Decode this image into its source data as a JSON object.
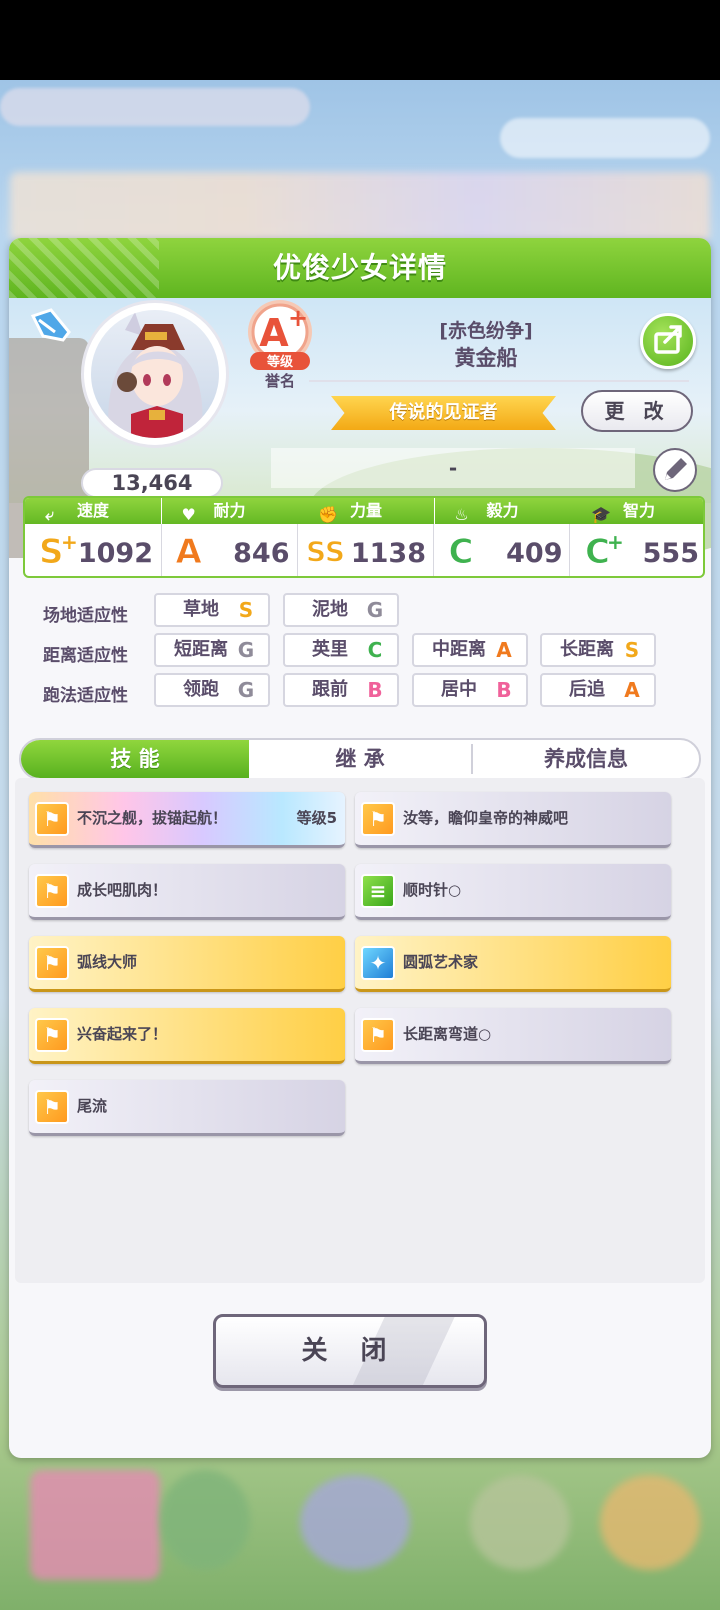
{
  "background": {
    "top_banner_text": "",
    "top_right_button": ""
  },
  "panel": {
    "title": "优俊少女详情"
  },
  "profile": {
    "points": "13,464",
    "grade": "A+",
    "grade_label": "等级",
    "grade_sub": "誉名",
    "outfit": "[赤色纷争]",
    "name": "黄金船",
    "epithet": "传说的见证者",
    "change_label": "更 改",
    "motto": "-"
  },
  "stats": [
    {
      "label": "速度",
      "icon": "shoe-icon",
      "glyph": "⤶",
      "rank": "S",
      "plus": true,
      "value": "1092",
      "rank_color": "#f2a81a"
    },
    {
      "label": "耐力",
      "icon": "heart-icon",
      "glyph": "♥",
      "rank": "A",
      "plus": false,
      "value": "846",
      "rank_color": "#f07a1e"
    },
    {
      "label": "力量",
      "icon": "arm-icon",
      "glyph": "✊",
      "rank": "SS",
      "plus": false,
      "value": "1138",
      "rank_color": "#f2a81a"
    },
    {
      "label": "毅力",
      "icon": "flame-icon",
      "glyph": "♨",
      "rank": "C",
      "plus": false,
      "value": "409",
      "rank_color": "#3fb24f"
    },
    {
      "label": "智力",
      "icon": "cap-icon",
      "glyph": "🎓",
      "rank": "C",
      "plus": true,
      "value": "555",
      "rank_color": "#3fb24f"
    }
  ],
  "aptitude": {
    "track_label": "场地适应性",
    "distance_label": "距离适应性",
    "style_label": "跑法适应性",
    "track": [
      {
        "name": "草地",
        "grade": "S"
      },
      {
        "name": "泥地",
        "grade": "G"
      }
    ],
    "distance": [
      {
        "name": "短距离",
        "grade": "G"
      },
      {
        "name": "英里",
        "grade": "C"
      },
      {
        "name": "中距离",
        "grade": "A"
      },
      {
        "name": "长距离",
        "grade": "S"
      }
    ],
    "style": [
      {
        "name": "领跑",
        "grade": "G"
      },
      {
        "name": "跟前",
        "grade": "B"
      },
      {
        "name": "居中",
        "grade": "B"
      },
      {
        "name": "后追",
        "grade": "A"
      }
    ]
  },
  "grade_colors": {
    "S": "#f2a81a",
    "A": "#f07a1e",
    "B": "#f0619a",
    "C": "#3fb24f",
    "G": "#8f8b99"
  },
  "tabs": [
    "技 能",
    "继 承",
    "养成信息"
  ],
  "skills": [
    {
      "name": "不沉之舰，拔锚起航！",
      "level": "等级5",
      "style": "rainbow",
      "icon": "orange"
    },
    {
      "name": "汝等，瞻仰皇帝的神威吧",
      "level": "",
      "style": "gray",
      "icon": "orange"
    },
    {
      "name": "成长吧肌肉！",
      "level": "",
      "style": "gray",
      "icon": "orange"
    },
    {
      "name": "顺时针○",
      "level": "",
      "style": "gray",
      "icon": "green"
    },
    {
      "name": "弧线大师",
      "level": "",
      "style": "gold",
      "icon": "orange"
    },
    {
      "name": "圆弧艺术家",
      "level": "",
      "style": "gold",
      "icon": "blue"
    },
    {
      "name": "兴奋起来了！",
      "level": "",
      "style": "gold",
      "icon": "orange"
    },
    {
      "name": "长距离弯道○",
      "level": "",
      "style": "gray",
      "icon": "orange"
    },
    {
      "name": "尾流",
      "level": "",
      "style": "gray",
      "icon": "orange"
    }
  ],
  "close_label": "关 闭"
}
